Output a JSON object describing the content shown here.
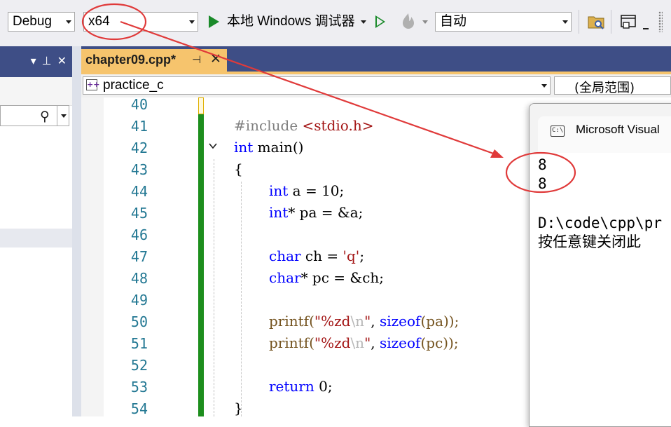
{
  "toolbar": {
    "config": "Debug",
    "platform": "x64",
    "start_label": "本地 Windows 调试器",
    "auto": "自动"
  },
  "editor": {
    "tab_title": "chapter09.cpp*",
    "scope": "practice_c",
    "global_scope": "(全局范围)",
    "lines": [
      {
        "n": "40"
      },
      {
        "n": "41"
      },
      {
        "n": "42"
      },
      {
        "n": "43"
      },
      {
        "n": "44"
      },
      {
        "n": "45"
      },
      {
        "n": "46"
      },
      {
        "n": "47"
      },
      {
        "n": "48"
      },
      {
        "n": "49"
      },
      {
        "n": "50"
      },
      {
        "n": "51"
      },
      {
        "n": "52"
      },
      {
        "n": "53"
      },
      {
        "n": "54"
      }
    ],
    "code": {
      "include_kw": "#include",
      "include_hdr": "<stdio.h>",
      "int1": "int",
      "main": " main()",
      "brace_open": "{",
      "int2": "int",
      "a_decl": " a = 10;",
      "int3": "int",
      "pa_decl": "* pa = &a;",
      "char1": "char",
      "ch_decl": " ch = ",
      "q_lit": "'q'",
      "semi1": ";",
      "char2": "char",
      "pc_decl": "* pc = &ch;",
      "printf1": "printf(",
      "fmt1a": "\"%zd",
      "fmt1b": "\\n",
      "fmt1c": "\"",
      "comma1": ", ",
      "sizeof1": "sizeof",
      "arg1": "(pa));",
      "printf2": "printf(",
      "fmt2a": "\"%zd",
      "fmt2b": "\\n",
      "fmt2c": "\"",
      "comma2": ", ",
      "sizeof2": "sizeof",
      "arg2": "(pc));",
      "return_kw": "return",
      "return_val": " 0;",
      "brace_close": "}"
    }
  },
  "console": {
    "title": "Microsoft Visual",
    "output": [
      "8",
      "8",
      "",
      "D:\\code\\cpp\\pr",
      "按任意键关闭此"
    ]
  },
  "colors": {
    "annotation": "#e03a3a",
    "accent_tab": "#f6c46d",
    "title_bar": "#3e4e86",
    "change_bar": "#1d8e1d",
    "keyword": "#0000ff",
    "string": "#a31515"
  }
}
